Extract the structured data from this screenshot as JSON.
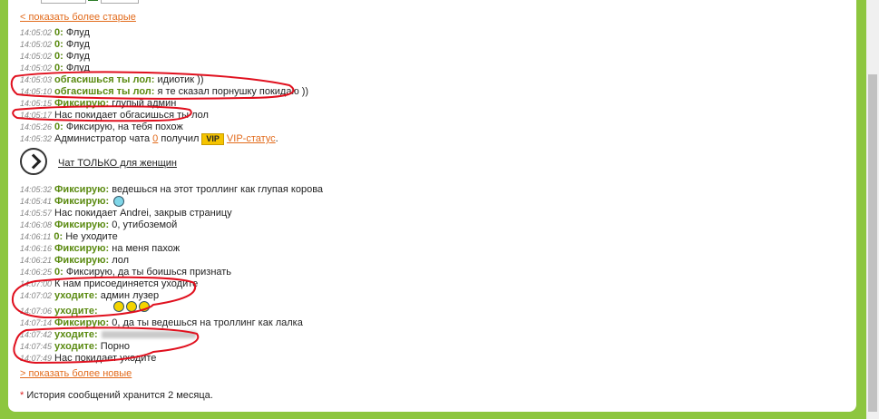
{
  "links": {
    "older": "< показать более старые",
    "newer": "> показать более новые"
  },
  "messages_top": [
    {
      "time": "14:05:02",
      "nick": "0:",
      "text": "Флуд"
    },
    {
      "time": "14:05:02",
      "nick": "0:",
      "text": "Флуд"
    },
    {
      "time": "14:05:02",
      "nick": "0:",
      "text": "Флуд"
    },
    {
      "time": "14:05:02",
      "nick": "0:",
      "text": "Флуд"
    },
    {
      "time": "14:05:03",
      "nick": "обгасишься ты лол:",
      "text": "идиотик ))"
    },
    {
      "time": "14:05:10",
      "nick": "обгасишься ты лол:",
      "text": "я те сказал порнушку покидаю ))"
    },
    {
      "time": "14:05:15",
      "nick": "Фиксирую:",
      "text": "глупый админ"
    },
    {
      "time": "14:05:17",
      "nick": "",
      "text": "Нас покидает обгасишься ты лол"
    },
    {
      "time": "14:05:26",
      "nick": "0:",
      "text": "Фиксирую, на тебя похож"
    }
  ],
  "vip_message": {
    "time": "14:05:32",
    "text_before": "Администратор чата",
    "user": "0",
    "text_mid": "получил",
    "badge": "VIP",
    "link": "VIP-статус",
    "dot": "."
  },
  "women_chat": "Чат ТОЛЬКО для женщин",
  "messages_bottom": [
    {
      "time": "14:05:32",
      "nick": "Фиксирую:",
      "text": "ведешься на этот троллинг как глупая корова"
    },
    {
      "time": "14:05:41",
      "nick": "Фиксирую:",
      "text": ""
    },
    {
      "time": "14:05:57",
      "nick": "",
      "text": "Нас покидает Andrei, закрыв страницу"
    },
    {
      "time": "14:06:08",
      "nick": "Фиксирую:",
      "text": "0, утибоземой"
    },
    {
      "time": "14:06:11",
      "nick": "0:",
      "text": "Не уходите"
    },
    {
      "time": "14:06:16",
      "nick": "Фиксирую:",
      "text": "на меня пахож"
    },
    {
      "time": "14:06:21",
      "nick": "Фиксирую:",
      "text": "лол"
    },
    {
      "time": "14:06:25",
      "nick": "0:",
      "text": "Фиксирую, да ты боишься признать"
    },
    {
      "time": "14:07:00",
      "nick": "",
      "text": "К нам присоединяется уходите"
    },
    {
      "time": "14:07:02",
      "nick": "уходите:",
      "text": "админ лузер"
    },
    {
      "time": "14:07:06",
      "nick": "уходите:",
      "text": ""
    },
    {
      "time": "14:07:14",
      "nick": "Фиксирую:",
      "text": "0, да ты ведешься на троллинг как лалка"
    },
    {
      "time": "14:07:42",
      "nick": "уходите:",
      "text": ""
    },
    {
      "time": "14:07:45",
      "nick": "уходите:",
      "text": "Порно"
    },
    {
      "time": "14:07:49",
      "nick": "",
      "text": "Нас покидает уходите"
    }
  ],
  "footnote": {
    "star": "*",
    "text": "История сообщений хранится 2 месяца."
  },
  "colors": {
    "background": "#8dc63f",
    "nick": "#5a8a10",
    "link": "#e26b1c",
    "annotation": "#e0101e"
  }
}
